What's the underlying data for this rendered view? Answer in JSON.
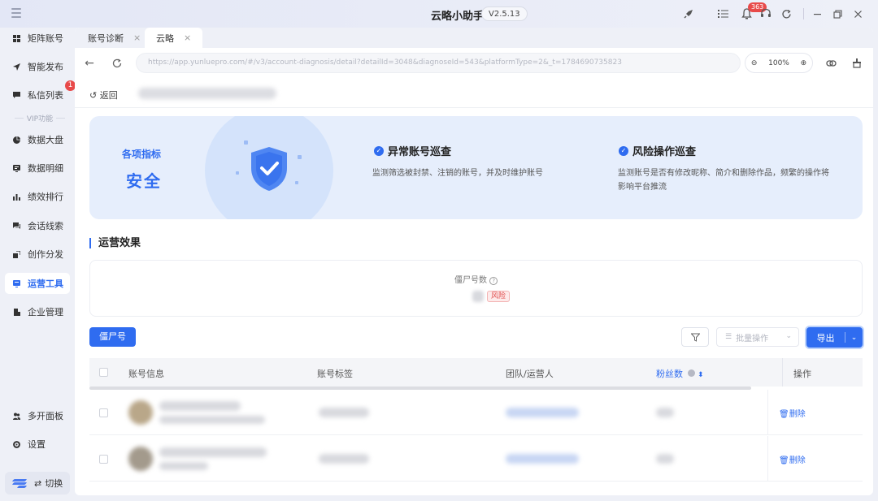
{
  "app": {
    "title": "云略小助手",
    "version": "V2.5.13",
    "notification_count": "363"
  },
  "sidebar": {
    "items": [
      {
        "label": "矩阵账号",
        "icon": "grid-icon"
      },
      {
        "label": "智能发布",
        "icon": "send-icon"
      },
      {
        "label": "私信列表",
        "icon": "message-icon",
        "badge": "1"
      },
      {
        "label": "数据大盘",
        "icon": "pie-chart-icon"
      },
      {
        "label": "数据明细",
        "icon": "detail-icon"
      },
      {
        "label": "绩效排行",
        "icon": "bar-chart-icon"
      },
      {
        "label": "会话线索",
        "icon": "chat-icon"
      },
      {
        "label": "创作分发",
        "icon": "share-icon"
      },
      {
        "label": "运营工具",
        "icon": "tool-icon",
        "active": true
      },
      {
        "label": "企业管理",
        "icon": "building-icon"
      }
    ],
    "vip_label": "VIP功能",
    "bottom": [
      {
        "label": "多开面板",
        "icon": "users-icon"
      },
      {
        "label": "设置",
        "icon": "gear-icon"
      }
    ],
    "switch_label": "切换"
  },
  "tabs": [
    {
      "label": "账号诊断"
    },
    {
      "label": "云略",
      "active": true
    }
  ],
  "browser": {
    "url": "https://app.yunluepro.com/#/v3/account-diagnosis/detail?detailId=3048&diagnoseId=543&platformType=2&_t=1784690735823",
    "zoom": "100%"
  },
  "page": {
    "back_label": "返回"
  },
  "banner": {
    "metric_label": "各项指标",
    "metric_value": "安全",
    "checks": [
      {
        "title": "异常账号巡查",
        "desc": "监测筛选被封禁、注销的账号，并及时维护账号"
      },
      {
        "title": "风险操作巡查",
        "desc_line1": "监测账号是否有修改昵称、简介和删除作品，频繁的操作将",
        "desc_line2": "影响平台推流"
      }
    ]
  },
  "section": {
    "title": "运营效果",
    "stat_label": "僵尸号数",
    "stat_tag": "风险"
  },
  "toolbar": {
    "zombie_button": "僵尸号",
    "batch_placeholder": "批量操作",
    "export_button": "导出"
  },
  "table": {
    "columns": [
      "账号信息",
      "账号标签",
      "团队/运营人",
      "粉丝数",
      "操作"
    ],
    "rows": [
      {
        "action": "删除"
      },
      {
        "action": "删除"
      }
    ]
  },
  "colors": {
    "accent": "#2f6cf0",
    "danger": "#e84a4a",
    "sidebar_bg": "#eef0f7"
  }
}
